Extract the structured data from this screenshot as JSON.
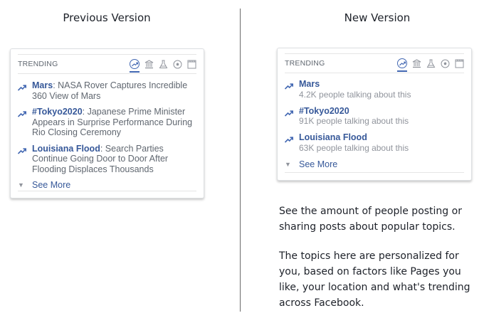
{
  "headings": {
    "left": "Previous Version",
    "right": "New Version"
  },
  "widget_title": "TRENDING",
  "colors": {
    "link": "#365899",
    "accent": "#4267b2",
    "muted": "#90949c"
  },
  "category_icons": [
    "trending-icon",
    "politics-icon",
    "science-icon",
    "sports-icon",
    "entertainment-icon"
  ],
  "previous": {
    "items": [
      {
        "topic": "Mars",
        "headline": ": NASA Rover Captures Incredible 360 View of Mars"
      },
      {
        "topic": "#Tokyo2020",
        "headline": ": Japanese Prime Minister Appears in Surprise Performance During Rio Closing Ceremony"
      },
      {
        "topic": "Louisiana Flood",
        "headline": ": Search Parties Continue Going Door to Door After Flooding Displaces Thousands"
      }
    ],
    "see_more": "See More"
  },
  "new": {
    "items": [
      {
        "topic": "Mars",
        "count": "4.2K people talking about this"
      },
      {
        "topic": "#Tokyo2020",
        "count": "91K people talking about this"
      },
      {
        "topic": "Louisiana Flood",
        "count": "63K people talking about this"
      }
    ],
    "see_more": "See More"
  },
  "description": {
    "p1": "See the amount of people posting or sharing posts about popular topics.",
    "p2": "The topics here are personalized for you, based on factors like Pages you like, your location and what's trending across Facebook."
  }
}
